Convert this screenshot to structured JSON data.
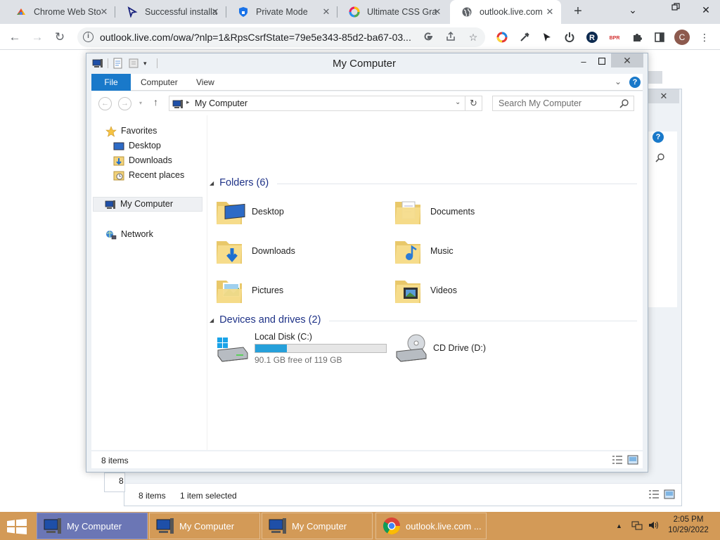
{
  "browser": {
    "tabs": [
      {
        "title": "Chrome Web Sto",
        "icon": "chrome-web-store-icon"
      },
      {
        "title": "Successful installa",
        "icon": "cursor-arrow-icon"
      },
      {
        "title": "Private Mode",
        "icon": "shield-icon"
      },
      {
        "title": "Ultimate CSS Gra",
        "icon": "gradient-circle-icon"
      },
      {
        "title": "outlook.live.com",
        "icon": "globe-icon"
      }
    ],
    "active_tab_index": 4,
    "new_tab_label": "+",
    "url": "outlook.live.com/owa/?nlp=1&RpsCsrfState=79e5e343-85d2-ba67-03...",
    "avatar_letter": "C",
    "extensions": [
      "google-icon",
      "share-icon",
      "star-icon",
      "color-ring-icon",
      "eyedropper-icon",
      "cursor-icon",
      "power-icon",
      "r-logo-icon",
      "bpr-icon",
      "puzzle-icon",
      "sidepanel-icon",
      "more-vert-icon"
    ]
  },
  "explorer": {
    "title": "My Computer",
    "ribbon_tabs": [
      "File",
      "Computer",
      "View"
    ],
    "breadcrumb": "My Computer",
    "search_placeholder": "Search My Computer",
    "nav": {
      "favorites_label": "Favorites",
      "favorites": [
        "Desktop",
        "Downloads",
        "Recent places"
      ],
      "computer_label": "My Computer",
      "network_label": "Network"
    },
    "folders_header": "Folders (6)",
    "folders": [
      {
        "name": "Desktop",
        "icon": "desktop-folder-icon"
      },
      {
        "name": "Documents",
        "icon": "documents-folder-icon"
      },
      {
        "name": "Downloads",
        "icon": "downloads-folder-icon"
      },
      {
        "name": "Music",
        "icon": "music-folder-icon"
      },
      {
        "name": "Pictures",
        "icon": "pictures-folder-icon"
      },
      {
        "name": "Videos",
        "icon": "videos-folder-icon"
      }
    ],
    "drives_header": "Devices and drives (2)",
    "drives": [
      {
        "name": "Local Disk (C:)",
        "free_text": "90.1 GB free of 119 GB",
        "used_fraction": 0.243
      },
      {
        "name": "CD Drive (D:)"
      }
    ],
    "status_items": "8 items"
  },
  "background_window": {
    "status_items": "8 items",
    "status_selected": "1 item selected",
    "corner_text": "8"
  },
  "taskbar": {
    "buttons": [
      {
        "label": "My Computer",
        "active": true
      },
      {
        "label": "My Computer",
        "active": false
      },
      {
        "label": "My Computer",
        "active": false
      },
      {
        "label": "outlook.live.com ...",
        "active": false
      }
    ],
    "time": "2:05 PM",
    "date": "10/29/2022"
  },
  "colors": {
    "taskbar": "#d39a57",
    "file_tab": "#1979ca",
    "group_header": "#1e3287",
    "disk_bar": "#26a0da"
  }
}
